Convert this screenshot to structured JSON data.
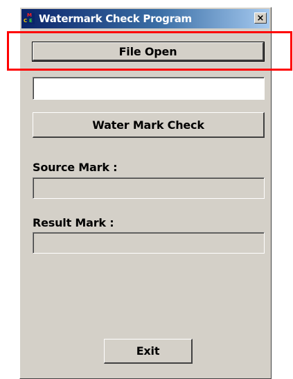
{
  "window": {
    "title": "Watermark Check Program",
    "close_label": "×"
  },
  "buttons": {
    "file_open": "File Open",
    "water_mark_check": "Water Mark Check",
    "exit": "Exit"
  },
  "fields": {
    "file_path": {
      "value": ""
    },
    "source_mark": {
      "label": "Source Mark :",
      "value": ""
    },
    "result_mark": {
      "label": "Result Mark :",
      "value": ""
    }
  },
  "annotation": {
    "color": "#ff0000",
    "target": "file-open-button"
  },
  "colors": {
    "face": "#d4d0c8",
    "titlebar": "#0a246a"
  }
}
